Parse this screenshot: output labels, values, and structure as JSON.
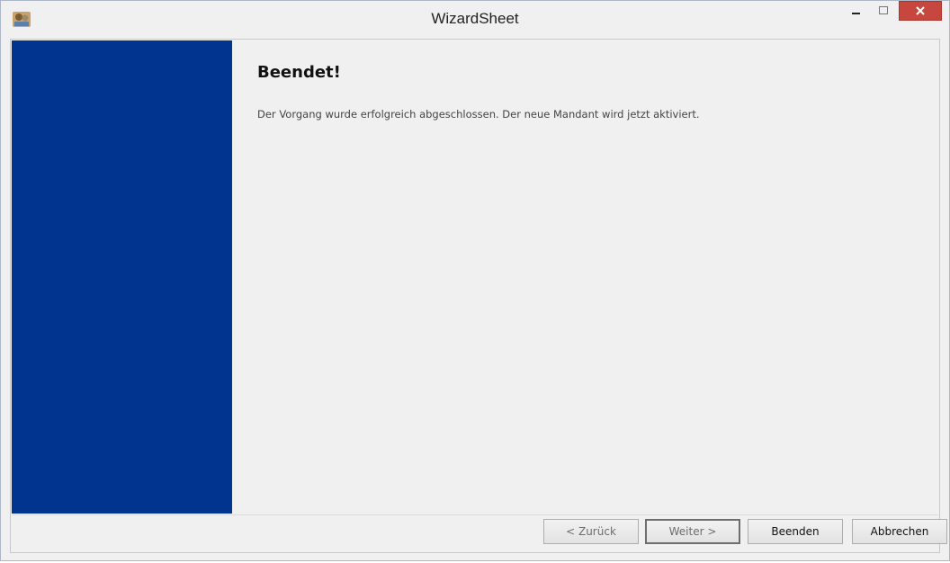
{
  "window": {
    "title": "WizardSheet",
    "controls": {
      "minimize_icon": "minimize-icon",
      "maximize_icon": "maximize-icon",
      "close_icon": "close-icon",
      "close_color": "#c7463e"
    }
  },
  "wizard": {
    "side_panel_color": "#00348f",
    "heading": "Beendet!",
    "message": "Der Vorgang wurde erfolgreich abgeschlossen. Der neue Mandant wird jetzt aktiviert."
  },
  "buttons": {
    "back": "< Zurück",
    "next": "Weiter >",
    "finish": "Beenden",
    "cancel": "Abbrechen"
  }
}
